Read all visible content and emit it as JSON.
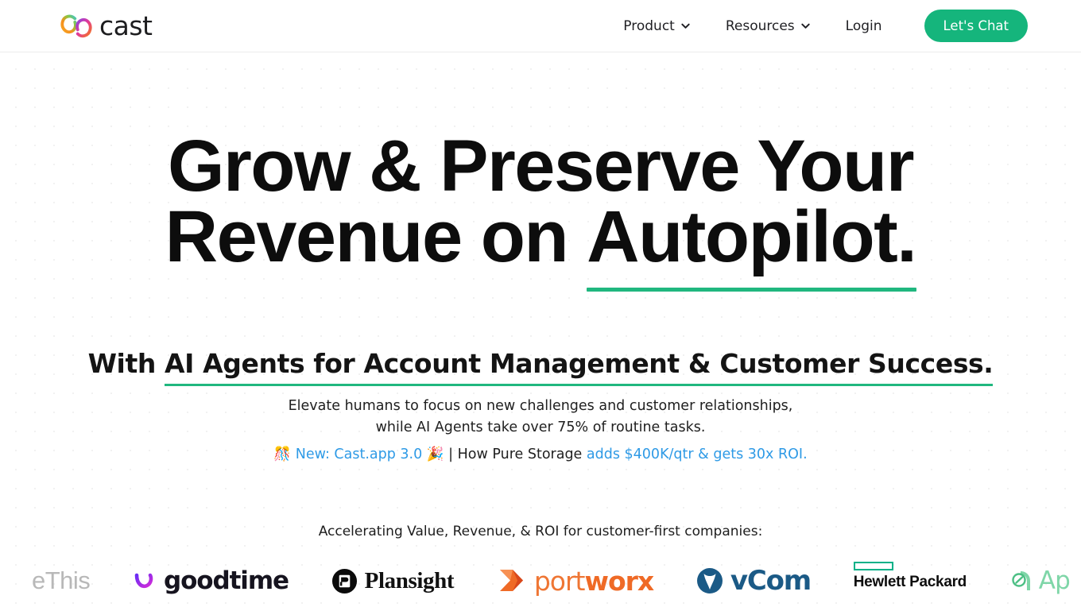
{
  "header": {
    "brand": {
      "name": "cast",
      "logo_icon": "cast-loop-logo"
    },
    "nav": [
      {
        "label": "Product",
        "icon": "chevron-down-icon",
        "has_dropdown": true
      },
      {
        "label": "Resources",
        "icon": "chevron-down-icon",
        "has_dropdown": true
      },
      {
        "label": "Login",
        "has_dropdown": false
      }
    ],
    "cta": {
      "label": "Let's Chat",
      "color": "#15b57c"
    }
  },
  "hero": {
    "headline_line1": "Grow & Preserve Your",
    "headline_line2_pre": "Revenue on ",
    "headline_line2_underlined": "Autopilot.",
    "subhead_pre": "With ",
    "subhead_underlined": "AI Agents for Account Management & Customer Success.",
    "lede_line1": "Elevate humans to focus on new challenges and customer relationships,",
    "lede_line2": "while AI Agents take over 75% of routine tasks.",
    "announce": {
      "emoji_left": "🎊",
      "new_label": "New: Cast.app 3.0",
      "emoji_right": "🎉",
      "separator": " | ",
      "middle_text": "How Pure Storage ",
      "link_text": "adds $400K/qtr & gets 30x ROI.",
      "link_color": "#2e9ae6"
    },
    "underline_color": "#20b77f"
  },
  "logos": {
    "caption": "Accelerating Value, Revenue, & ROI for customer-first companies:",
    "items": [
      {
        "name": "ShareThis",
        "visible_text": "eThis",
        "icon": "sharethis-logo"
      },
      {
        "name": "GoodTime",
        "visible_text": "goodtime",
        "icon": "goodtime-swoosh-icon"
      },
      {
        "name": "Plansight",
        "visible_text": "Plansight",
        "icon": "plansight-circle-icon"
      },
      {
        "name": "Portworx",
        "visible_text_light": "port",
        "visible_text_bold": "worx",
        "icon": "portworx-arrow-icon"
      },
      {
        "name": "vCom",
        "visible_text": "vCom",
        "icon": "vcom-circle-icon"
      },
      {
        "name": "Hewlett Packard Enterprise",
        "visible_text": "Hewlett Packard",
        "icon": "hpe-bar-icon"
      },
      {
        "name": "Apptio",
        "visible_text": "Ap",
        "icon": "apptio-gauge-icon"
      }
    ]
  }
}
